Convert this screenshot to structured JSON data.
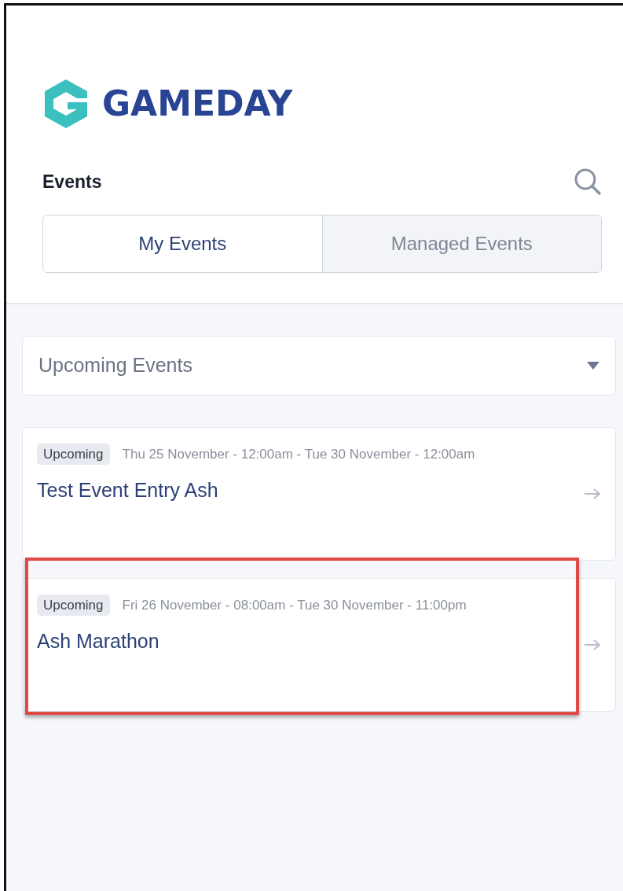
{
  "logo": {
    "text": "GAMEDAY"
  },
  "header": {
    "title": "Events"
  },
  "tabs": [
    {
      "label": "My Events",
      "selected": true
    },
    {
      "label": "Managed Events",
      "selected": false
    }
  ],
  "filter": {
    "value": "Upcoming Events"
  },
  "events": [
    {
      "status": "Upcoming",
      "dates": "Thu 25 November - 12:00am - Tue 30 November - 12:00am",
      "title": "Test Event Entry Ash",
      "highlighted": false
    },
    {
      "status": "Upcoming",
      "dates": "Fri 26 November - 08:00am - Tue 30 November - 11:00pm",
      "title": "Ash Marathon",
      "highlighted": true
    }
  ]
}
